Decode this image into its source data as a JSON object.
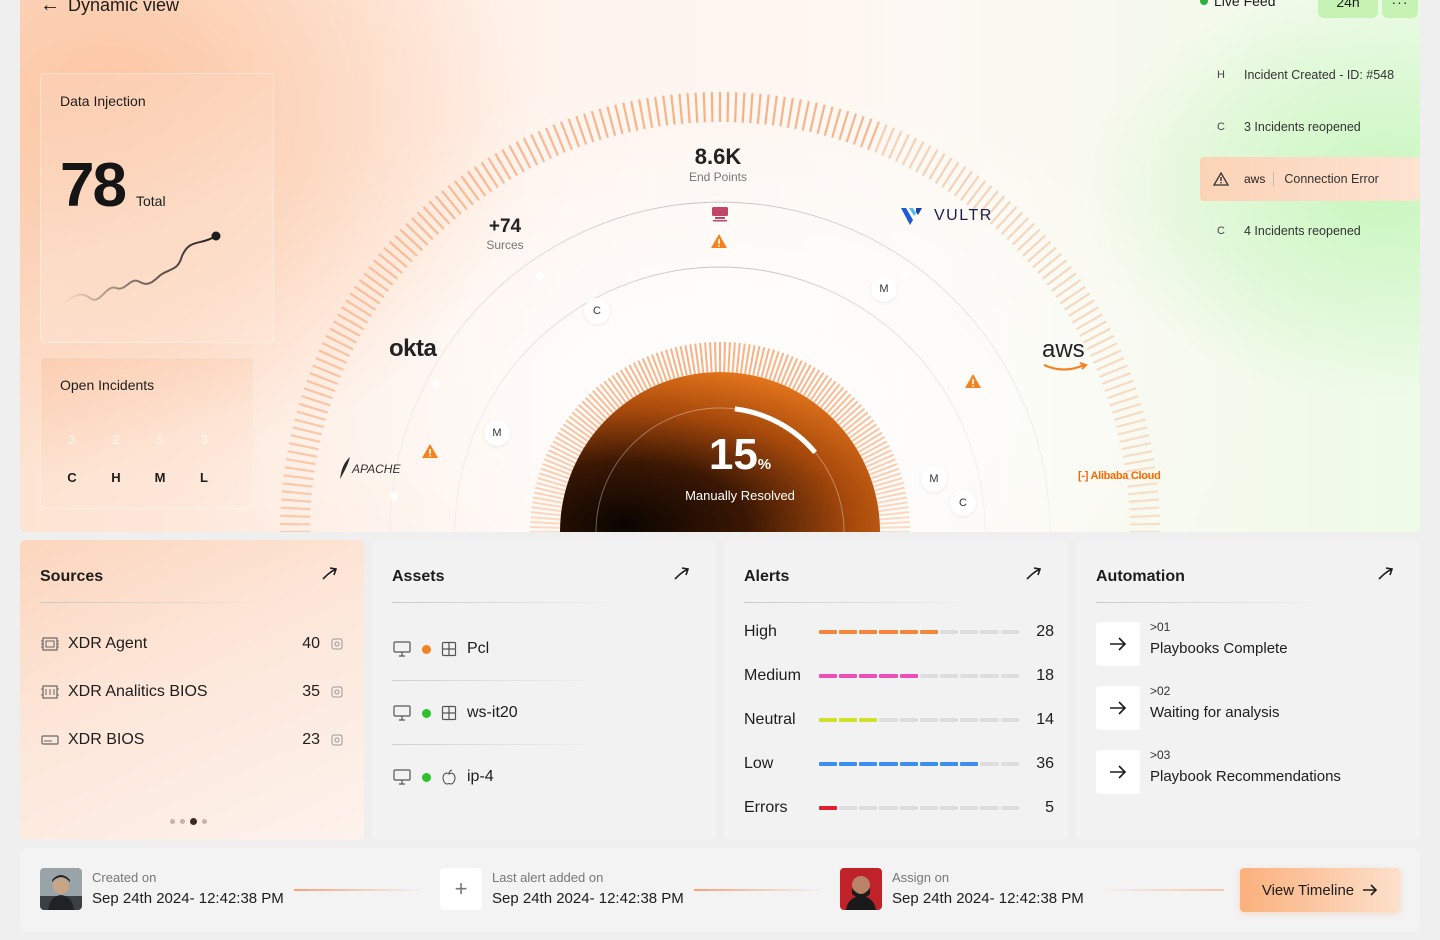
{
  "header": {
    "back_icon": "arrow-left-icon",
    "title": "Dynamic view"
  },
  "live_feed": {
    "label": "Live Feed",
    "status_color": "#2ab03e",
    "range": "24h",
    "more": "···",
    "items": [
      {
        "chip": "H",
        "text": "Incident Created - ID: #548",
        "highlight": false
      },
      {
        "chip": "C",
        "text": "3 Incidents reopened",
        "highlight": false
      },
      {
        "chip": "warning-icon",
        "brand": "aws",
        "text": "Connection Error",
        "highlight": true
      },
      {
        "chip": "C",
        "text": "4 Incidents reopened",
        "highlight": false
      }
    ]
  },
  "data_injection": {
    "title": "Data Injection",
    "value": "78",
    "unit": "Total"
  },
  "open_incidents": {
    "title": "Open Incidents",
    "columns": [
      {
        "label": "C",
        "value": "3"
      },
      {
        "label": "H",
        "value": "2"
      },
      {
        "label": "M",
        "value": "5"
      },
      {
        "label": "L",
        "value": "3"
      }
    ]
  },
  "gauge": {
    "endpoints_value": "8.6K",
    "endpoints_label": "End Points",
    "sources_value": "+74",
    "sources_label": "Surces",
    "percent_value": "15",
    "percent_unit": "%",
    "percent_label": "Manually Resolved",
    "percent_fraction": 0.15,
    "accent": "#f58220",
    "nodes": [
      "C",
      "M",
      "M",
      "M",
      "C"
    ],
    "brands": {
      "okta": "okta",
      "aws": "aws",
      "vultr": "VULTR",
      "apache": "APACHE",
      "alibaba": "Alibaba Cloud"
    }
  },
  "sources": {
    "title": "Sources",
    "items": [
      {
        "name": "XDR Agent",
        "count": "40"
      },
      {
        "name": "XDR Analitics BIOS",
        "count": "35"
      },
      {
        "name": "XDR BIOS",
        "count": "23"
      }
    ]
  },
  "assets": {
    "title": "Assets",
    "items": [
      {
        "name": "Pcl",
        "status_color": "#f58220",
        "os": "windows-icon"
      },
      {
        "name": "ws-it20",
        "status_color": "#2cc02c",
        "os": "windows-icon"
      },
      {
        "name": "ip-4",
        "status_color": "#2cc02c",
        "os": "apple-icon"
      }
    ]
  },
  "alerts": {
    "title": "Alerts",
    "items": [
      {
        "name": "High",
        "count": "28",
        "filled_segments": 6,
        "color": "#f5853a"
      },
      {
        "name": "Medium",
        "count": "18",
        "filled_segments": 5,
        "color": "#ec4fb8"
      },
      {
        "name": "Neutral",
        "count": "14",
        "filled_segments": 3,
        "color": "#d3e02a"
      },
      {
        "name": "Low",
        "count": "36",
        "filled_segments": 8,
        "color": "#3e8ef2"
      },
      {
        "name": "Errors",
        "count": "5",
        "filled_segments": 1,
        "color": "#e0202a"
      }
    ]
  },
  "automation": {
    "title": "Automation",
    "items": [
      {
        "num": ">01",
        "text": "Playbooks Complete"
      },
      {
        "num": ">02",
        "text": "Waiting for analysis"
      },
      {
        "num": ">03",
        "text": "Playbook Recommendations"
      }
    ]
  },
  "footer": {
    "created_label": "Created on",
    "created_value": "Sep 24th 2024- 12:42:38 PM",
    "alert_label": "Last alert added on",
    "alert_value": "Sep 24th 2024- 12:42:38 PM",
    "assign_label": "Assign on",
    "assign_value": "Sep 24th 2024- 12:42:38 PM",
    "button": "View Timeline"
  }
}
